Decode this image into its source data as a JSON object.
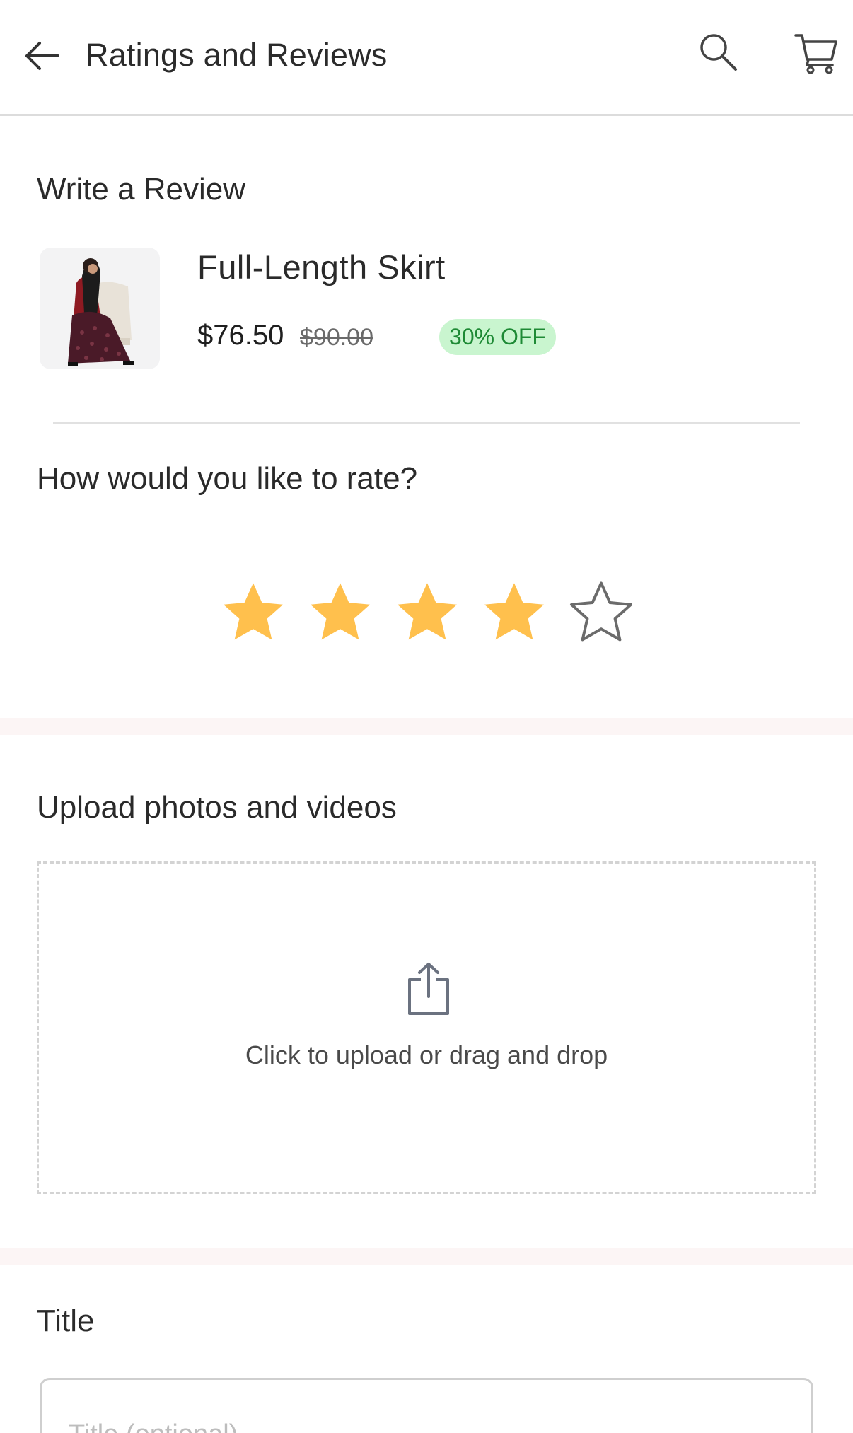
{
  "header": {
    "title": "Ratings and Reviews",
    "icons": [
      "back-arrow-icon",
      "search-icon",
      "cart-icon"
    ]
  },
  "review": {
    "heading": "Write a Review",
    "product": {
      "name": "Full-Length Skirt",
      "price": "$76.50",
      "original_price": "$90.00",
      "discount": "30% OFF"
    }
  },
  "rating": {
    "question": "How would you like to rate?",
    "value": 4,
    "max": 5,
    "filled_color": "#FFC04D",
    "empty_color": "#6b6b6b"
  },
  "upload": {
    "heading": "Upload photos and videos",
    "prompt": "Click to upload or drag and drop"
  },
  "title_field": {
    "label": "Title",
    "placeholder": "Title (optional)",
    "value": ""
  },
  "colors": {
    "discount_bg": "#C9F5CF",
    "discount_text": "#1E8A35",
    "section_band": "#FCF5F5"
  }
}
